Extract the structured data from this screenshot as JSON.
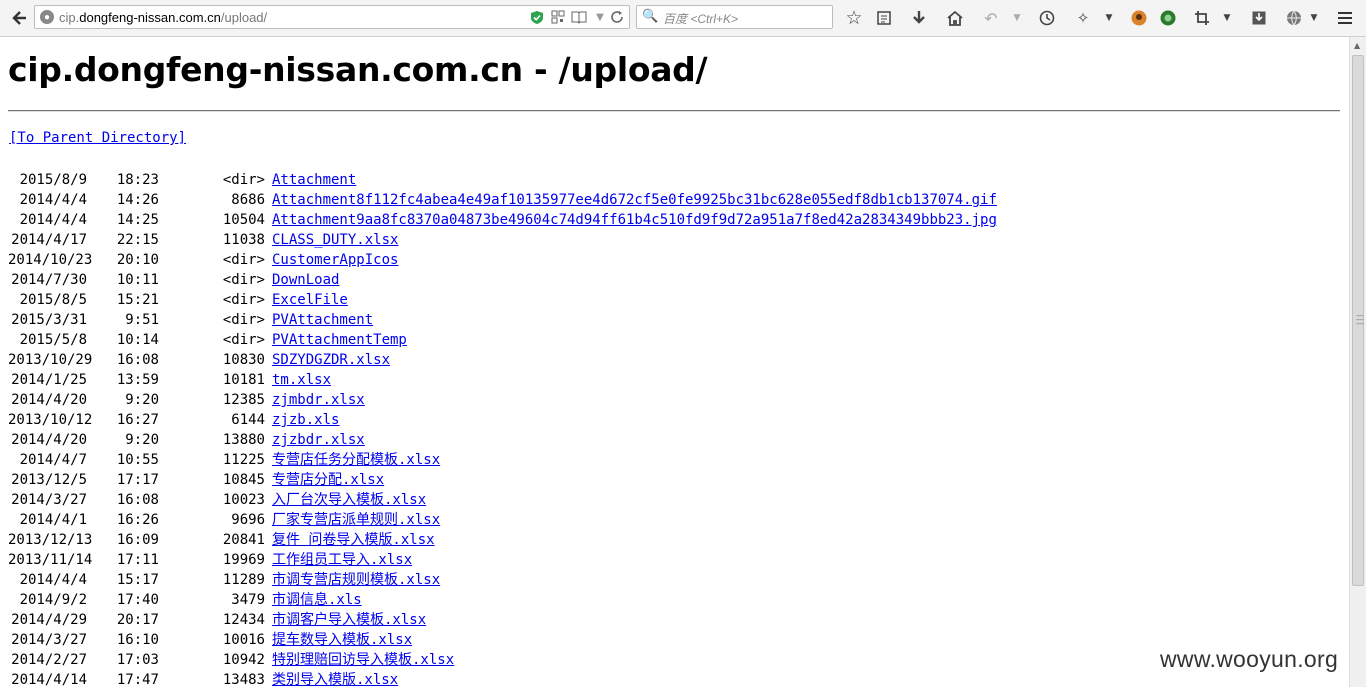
{
  "browser": {
    "url_prefix": "cip.",
    "url_host": "dongfeng-nissan.com.cn",
    "url_path": "/upload/",
    "search_placeholder": "百度 <Ctrl+K>",
    "icons": [
      "back-icon",
      "site-identity-icon",
      "shield-icon",
      "qr-icon",
      "reader-icon",
      "dropdown-icon",
      "reload-icon",
      "search-icon",
      "bookmark-star-icon",
      "bookmarks-list-icon",
      "download-icon",
      "home-icon",
      "undo-icon",
      "history-icon",
      "extension-icon",
      "avatar-icon",
      "green-addon-icon",
      "crop-icon",
      "save-icon",
      "globe-addon-icon",
      "menu-icon"
    ]
  },
  "page": {
    "title": "cip.dongfeng-nissan.com.cn - /upload/",
    "parent_link": "[To Parent Directory]"
  },
  "listing": [
    {
      "date": "2015/8/9",
      "time": "18:23",
      "size": "<dir>",
      "name": "Attachment"
    },
    {
      "date": "2014/4/4",
      "time": "14:26",
      "size": "8686",
      "name": "Attachment8f112fc4abea4e49af10135977ee4d672cf5e0fe9925bc31bc628e055edf8db1cb137074.gif"
    },
    {
      "date": "2014/4/4",
      "time": "14:25",
      "size": "10504",
      "name": "Attachment9aa8fc8370a04873be49604c74d94ff61b4c510fd9f9d72a951a7f8ed42a2834349bbb23.jpg"
    },
    {
      "date": "2014/4/17",
      "time": "22:15",
      "size": "11038",
      "name": "CLASS_DUTY.xlsx"
    },
    {
      "date": "2014/10/23",
      "time": "20:10",
      "size": "<dir>",
      "name": "CustomerAppIcos"
    },
    {
      "date": "2014/7/30",
      "time": "10:11",
      "size": "<dir>",
      "name": "DownLoad"
    },
    {
      "date": "2015/8/5",
      "time": "15:21",
      "size": "<dir>",
      "name": "ExcelFile"
    },
    {
      "date": "2015/3/31",
      "time": "9:51",
      "size": "<dir>",
      "name": "PVAttachment"
    },
    {
      "date": "2015/5/8",
      "time": "10:14",
      "size": "<dir>",
      "name": "PVAttachmentTemp"
    },
    {
      "date": "2013/10/29",
      "time": "16:08",
      "size": "10830",
      "name": "SDZYDGZDR.xlsx"
    },
    {
      "date": "2014/1/25",
      "time": "13:59",
      "size": "10181",
      "name": "tm.xlsx"
    },
    {
      "date": "2014/4/20",
      "time": "9:20",
      "size": "12385",
      "name": "zjmbdr.xlsx"
    },
    {
      "date": "2013/10/12",
      "time": "16:27",
      "size": "6144",
      "name": "zjzb.xls"
    },
    {
      "date": "2014/4/20",
      "time": "9:20",
      "size": "13880",
      "name": "zjzbdr.xlsx"
    },
    {
      "date": "2014/4/7",
      "time": "10:55",
      "size": "11225",
      "name": "专营店任务分配模板.xlsx"
    },
    {
      "date": "2013/12/5",
      "time": "17:17",
      "size": "10845",
      "name": "专营店分配.xlsx"
    },
    {
      "date": "2014/3/27",
      "time": "16:08",
      "size": "10023",
      "name": "入厂台次导入模板.xlsx"
    },
    {
      "date": "2014/4/1",
      "time": "16:26",
      "size": "9696",
      "name": "厂家专营店派单规则.xlsx"
    },
    {
      "date": "2013/12/13",
      "time": "16:09",
      "size": "20841",
      "name": "复件 问卷导入模版.xlsx"
    },
    {
      "date": "2013/11/14",
      "time": "17:11",
      "size": "19969",
      "name": "工作组员工导入.xlsx"
    },
    {
      "date": "2014/4/4",
      "time": "15:17",
      "size": "11289",
      "name": "市调专营店规则模板.xlsx"
    },
    {
      "date": "2014/9/2",
      "time": "17:40",
      "size": "3479",
      "name": "市调信息.xls"
    },
    {
      "date": "2014/4/29",
      "time": "20:17",
      "size": "12434",
      "name": "市调客户导入模板.xlsx"
    },
    {
      "date": "2014/3/27",
      "time": "16:10",
      "size": "10016",
      "name": "提车数导入模板.xlsx"
    },
    {
      "date": "2014/2/27",
      "time": "17:03",
      "size": "10942",
      "name": "特别理赔回访导入模板.xlsx"
    },
    {
      "date": "2014/4/14",
      "time": "17:47",
      "size": "13483",
      "name": "类别导入模版.xlsx"
    }
  ],
  "watermark": "www.wooyun.org",
  "colors": {
    "link": "#0000ee",
    "toolbar_bg": "#f4f4f4",
    "shield_green": "#2ea44f"
  }
}
